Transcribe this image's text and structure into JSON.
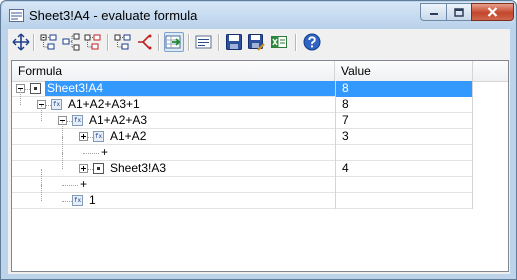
{
  "window": {
    "title": "Sheet3!A4 - evaluate formula"
  },
  "toolbar": {
    "buttons": [
      {
        "name": "move-icon"
      },
      {
        "name": "collapse-tree-icon"
      },
      {
        "name": "expand-tree-icon"
      },
      {
        "name": "expand-all-icon"
      },
      {
        "name": "tree-options-icon"
      },
      {
        "name": "branch-icon"
      },
      {
        "name": "goto-cell-icon"
      },
      {
        "name": "evaluate-step-icon"
      },
      {
        "name": "save-icon"
      },
      {
        "name": "save-as-icon"
      },
      {
        "name": "export-excel-icon"
      },
      {
        "name": "help-icon"
      }
    ]
  },
  "grid": {
    "columns": [
      "Formula",
      "Value"
    ],
    "rows": [
      {
        "formula": "Sheet3!A4",
        "value": "8",
        "depth": 0,
        "expander": "minus",
        "icon": "cell",
        "selected": true
      },
      {
        "formula": "A1+A2+A3+1",
        "value": "8",
        "depth": 1,
        "expander": "minus",
        "icon": "fx"
      },
      {
        "formula": "A1+A2+A3",
        "value": "7",
        "depth": 2,
        "expander": "minus",
        "icon": "fx"
      },
      {
        "formula": "A1+A2",
        "value": "3",
        "depth": 3,
        "expander": "plus",
        "icon": "fx"
      },
      {
        "formula": "+",
        "value": "",
        "depth": 3,
        "expander": "none",
        "icon": "none"
      },
      {
        "formula": "Sheet3!A3",
        "value": "4",
        "depth": 3,
        "expander": "plus",
        "icon": "cell"
      },
      {
        "formula": "+",
        "value": "",
        "depth": 2,
        "expander": "none",
        "icon": "none"
      },
      {
        "formula": "1",
        "value": "",
        "depth": 2,
        "expander": "none",
        "icon": "fx"
      }
    ]
  }
}
